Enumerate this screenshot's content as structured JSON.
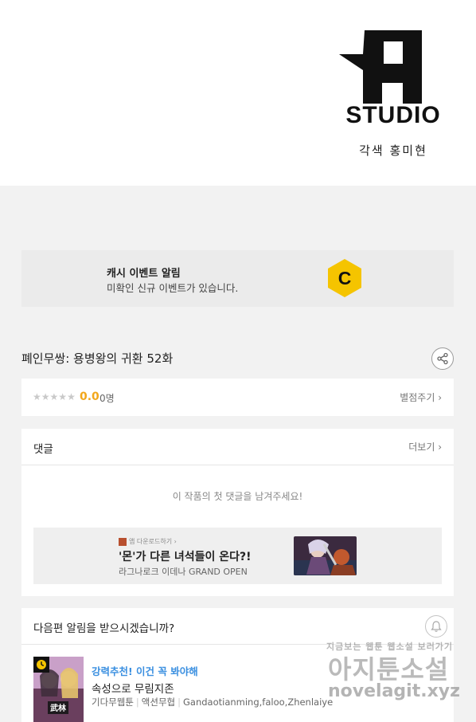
{
  "hero": {
    "logo_text": "STUDIO",
    "credit": "각색 홍미현"
  },
  "cash_event": {
    "title": "캐시 이벤트 알림",
    "subtitle": "미확인 신규 이벤트가 있습니다.",
    "coin_letter": "C",
    "coin_color": "#f5c400"
  },
  "episode": {
    "title": "폐인무쌍: 용병왕의 귀환 52화"
  },
  "rating": {
    "stars_filled": 0,
    "stars_total": 5,
    "score": "0.0",
    "count": "0명",
    "rate_label": "별점주기 ›"
  },
  "comments": {
    "title": "댓글",
    "more_label": "더보기 ›",
    "empty_message": "이 작품의 첫 댓글을 남겨주세요!"
  },
  "ad": {
    "small_label": "앱 다운로드하기 ›",
    "headline": "'몬'가 다른 녀석들이 온다?!",
    "sub": "라그나로크 이데나 GRAND OPEN"
  },
  "notify": {
    "question": "다음편 알림을 받으시겠습니까?"
  },
  "recommend": {
    "promo": "강력추천! 이건 꼭 봐야해",
    "title": "속성으로 무림지존",
    "meta": [
      "기다무웹툰",
      "액션무협",
      "Gandaotianming,faloo,Zhenlaiye"
    ],
    "accent_color": "#3a8fe0"
  },
  "watermark": {
    "top": "지금보는 웹툰 웹소설 보러가기",
    "main": "아지툰소설",
    "url": "novelagit.xyz"
  }
}
